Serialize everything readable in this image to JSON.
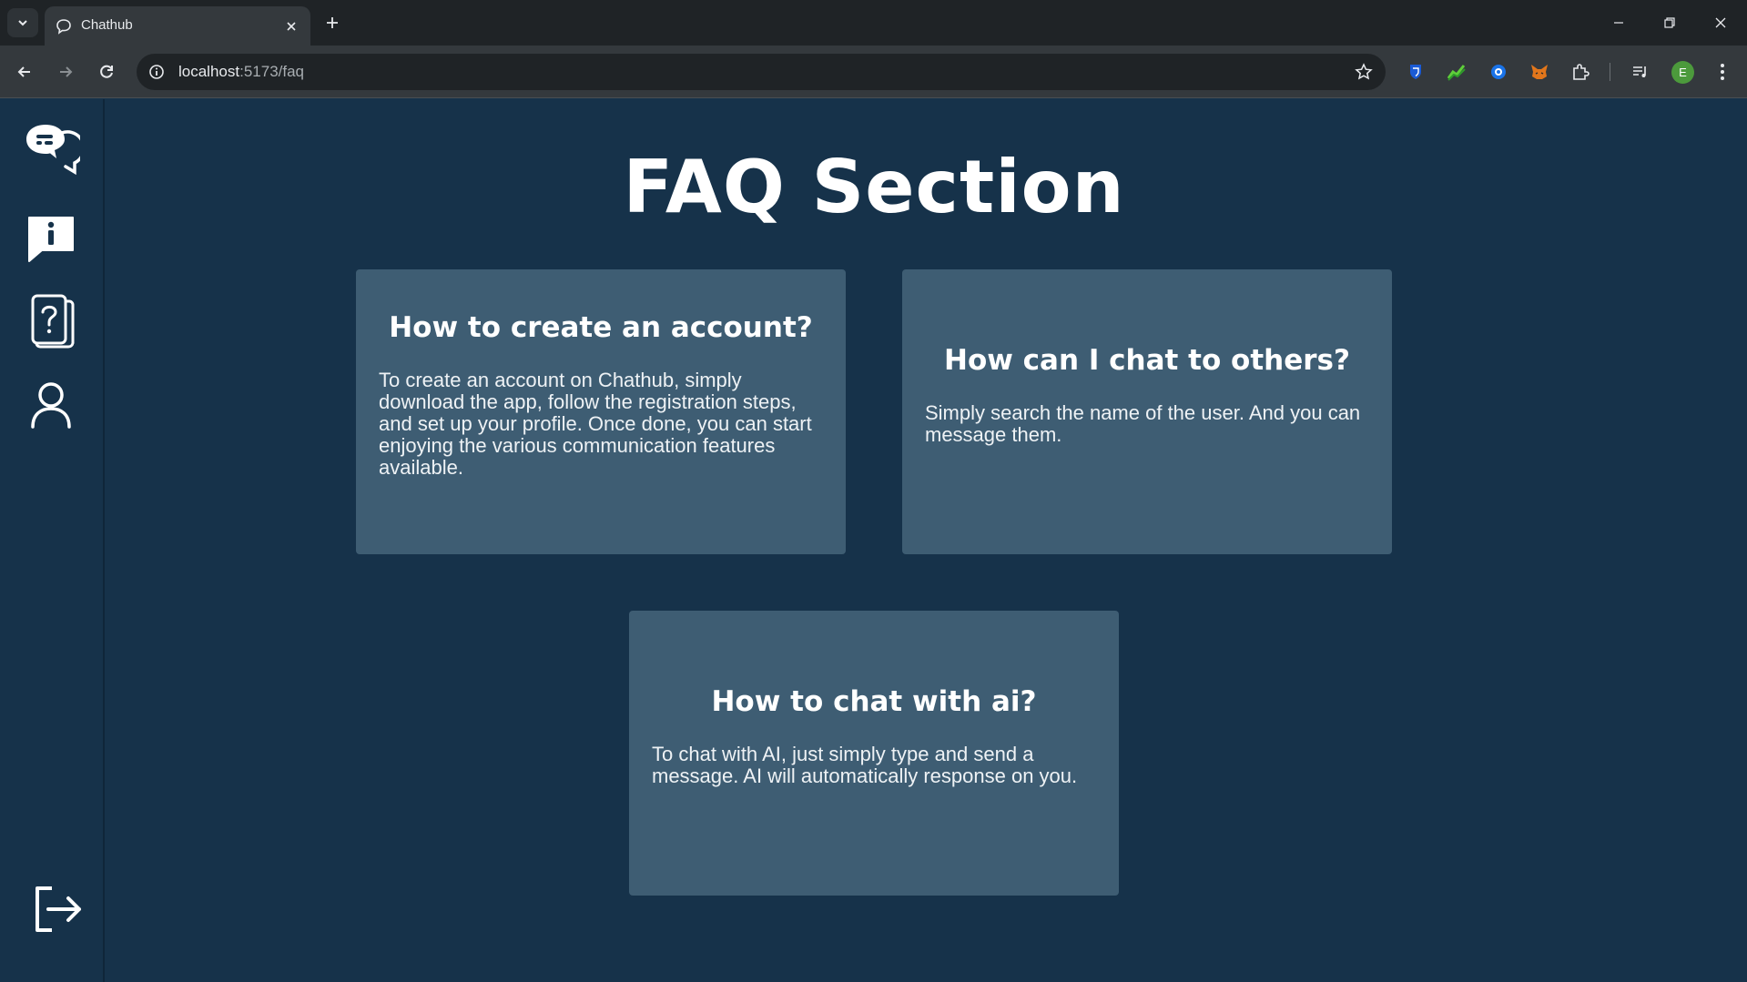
{
  "browser": {
    "tab_title": "Chathub",
    "url_host": "localhost",
    "url_path": ":5173/faq",
    "profile_initial": "E"
  },
  "sidebar": {
    "items": [
      {
        "name": "chat-icon"
      },
      {
        "name": "info-icon"
      },
      {
        "name": "faq-icon"
      },
      {
        "name": "profile-icon"
      }
    ],
    "logout": {
      "name": "logout-icon"
    }
  },
  "page": {
    "title": "FAQ Section",
    "faqs": [
      {
        "question": "How to create an account?",
        "answer": "To create an account on Chathub, simply download the app, follow the registration steps, and set up your profile. Once done, you can start enjoying the various communication features available."
      },
      {
        "question": "How can I chat to others?",
        "answer": "Simply search the name of the user. And you can message them."
      },
      {
        "question": "How to chat with ai?",
        "answer": "To chat with AI, just simply type and send a message. AI will automatically response on you."
      }
    ]
  },
  "colors": {
    "background": "#16324a",
    "card": "#3e5d73",
    "text": "#ffffff"
  }
}
